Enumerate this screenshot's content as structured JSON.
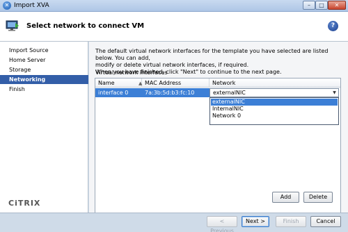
{
  "window": {
    "title": "Import XVA"
  },
  "header": {
    "title": "Select network to connect VM",
    "help": "?"
  },
  "sidebar": {
    "items": [
      {
        "label": "Import Source",
        "active": false
      },
      {
        "label": "Home Server",
        "active": false
      },
      {
        "label": "Storage",
        "active": false
      },
      {
        "label": "Networking",
        "active": true
      },
      {
        "label": "Finish",
        "active": false
      }
    ],
    "logo": "CiTRIX"
  },
  "main": {
    "description_line1": "The default virtual network interfaces for the template you have selected are listed below. You can add,",
    "description_line2": "modify or delete virtual network interfaces, if required.",
    "description_line3": "When you have finished, click \"Next\" to continue to the next page.",
    "grid_label": "Virtual network interfaces",
    "columns": [
      "Name",
      "MAC Address",
      "Network"
    ],
    "rows": [
      {
        "name": "interface 0",
        "mac": "7a:3b:5d:b3:fc:10",
        "network": "externalNIC"
      }
    ],
    "dropdown_options": [
      "externalNIC",
      "InternalNIC",
      "Network 0"
    ],
    "add_label": "Add",
    "delete_label": "Delete"
  },
  "footer": {
    "prev_label": "< Previous",
    "next_label": "Next >",
    "finish_label": "Finish",
    "cancel_label": "Cancel"
  },
  "colors": {
    "accent": "#335ea8",
    "selection": "#3c7fd6"
  }
}
